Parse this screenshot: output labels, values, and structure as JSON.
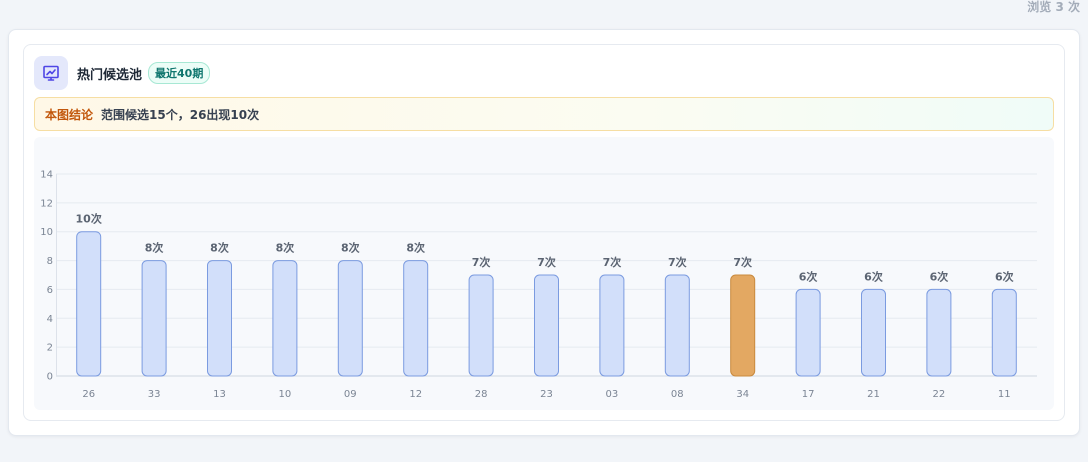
{
  "page": {
    "view_count": "浏览 3 次"
  },
  "card": {
    "title": "热门候选池",
    "badge": "最近40期",
    "conclusion_label": "本图结论",
    "conclusion_text": "范围候选15个，26出现10次",
    "icon": "chart-line-icon"
  },
  "colors": {
    "accent_icon": "#4f46e5",
    "bar_fill": "#d2dffa",
    "bar_stroke": "#7b9be0",
    "highlight_fill": "#e3a862",
    "highlight_stroke": "#c98a3e"
  },
  "chart_data": {
    "type": "bar",
    "categories": [
      "26",
      "33",
      "13",
      "10",
      "09",
      "12",
      "28",
      "23",
      "03",
      "08",
      "34",
      "17",
      "21",
      "22",
      "11"
    ],
    "values": [
      10,
      8,
      8,
      8,
      8,
      8,
      7,
      7,
      7,
      7,
      7,
      6,
      6,
      6,
      6
    ],
    "data_labels": [
      "10次",
      "8次",
      "8次",
      "8次",
      "8次",
      "8次",
      "7次",
      "7次",
      "7次",
      "7次",
      "7次",
      "6次",
      "6次",
      "6次",
      "6次"
    ],
    "highlight_category": "34",
    "ylim": [
      0,
      14
    ],
    "yticks": [
      0,
      2,
      4,
      6,
      8,
      10,
      12,
      14
    ],
    "grid": true,
    "title": "",
    "xlabel": "",
    "ylabel": ""
  }
}
